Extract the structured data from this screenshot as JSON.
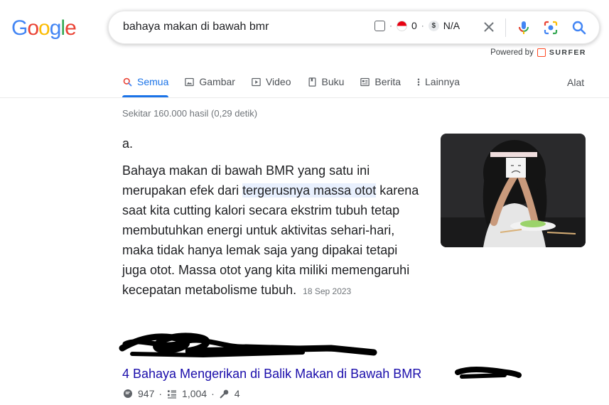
{
  "logo": {
    "letters": [
      "G",
      "o",
      "o",
      "g",
      "l",
      "e"
    ],
    "colors": [
      "#4285f4",
      "#ea4335",
      "#fbbc05",
      "#4285f4",
      "#34a853",
      "#ea4335"
    ]
  },
  "search": {
    "query": "bahaya makan di bawah bmr",
    "ext_count": "0",
    "ext_value": "N/A",
    "dollar_symbol": "$",
    "sep": "·"
  },
  "powered": {
    "label": "Powered by",
    "brand": "SURFER"
  },
  "tabs": [
    {
      "label": "Semua",
      "icon": "search-icon"
    },
    {
      "label": "Gambar",
      "icon": "image-icon"
    },
    {
      "label": "Video",
      "icon": "play-icon"
    },
    {
      "label": "Buku",
      "icon": "book-icon"
    },
    {
      "label": "Berita",
      "icon": "news-icon"
    },
    {
      "label": "Lainnya",
      "icon": "more-vert-icon"
    }
  ],
  "tools_label": "Alat",
  "stats": "Sekitar 160.000 hasil (0,29 detik)",
  "snippet": {
    "heading": "a.",
    "text_before": "Bahaya makan di bawah BMR yang satu ini merupakan efek dari ",
    "text_highlight": "tergerusnya massa otot",
    "text_after": " karena saat kita cutting kalori secara ekstrim tubuh tetap membutuhkan energi untuk aktivitas sehari-hari, maka tidak hanya lemak saja yang dipakai tetapi juga otot. Massa otot yang kita miliki memengaruhi kecepatan metabolisme tubuh.",
    "date": "18 Sep 2023"
  },
  "result": {
    "title": "4 Bahaya Mengerikan di Balik Makan di Bawah BMR",
    "metric_1": "947",
    "metric_2": "1,004",
    "metric_3": "4",
    "sep": "·"
  },
  "colors": {
    "link": "#1a0dab",
    "accent": "#1a73e8",
    "highlight": "#e8f0fe"
  }
}
